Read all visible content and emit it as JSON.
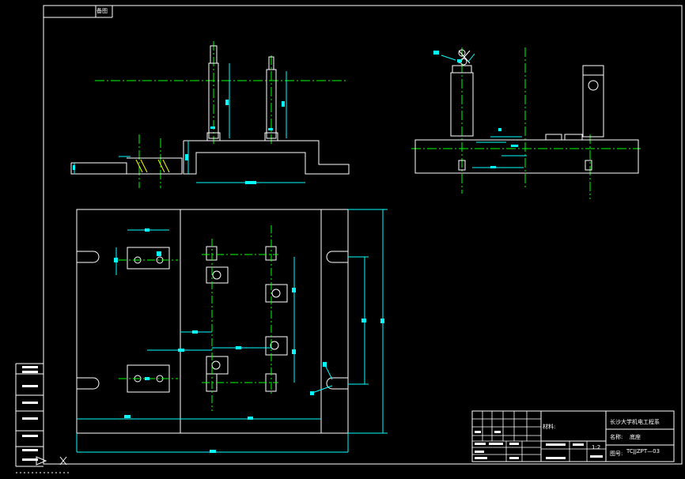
{
  "drawing": {
    "corner_tag": "备图",
    "title_block": {
      "material_label": "材料:",
      "school": "长沙大学机电工程系",
      "name_label": "名称:",
      "name_value": "底座",
      "drawing_no_label": "图号:",
      "drawing_no_value": "TCJJZPT—03",
      "scale": "1:2"
    }
  },
  "colors": {
    "background": "#000000",
    "outline": "#ffffff",
    "dimension": "#00ffff",
    "centerline": "#00ff00",
    "hatch": "#ffff00"
  }
}
